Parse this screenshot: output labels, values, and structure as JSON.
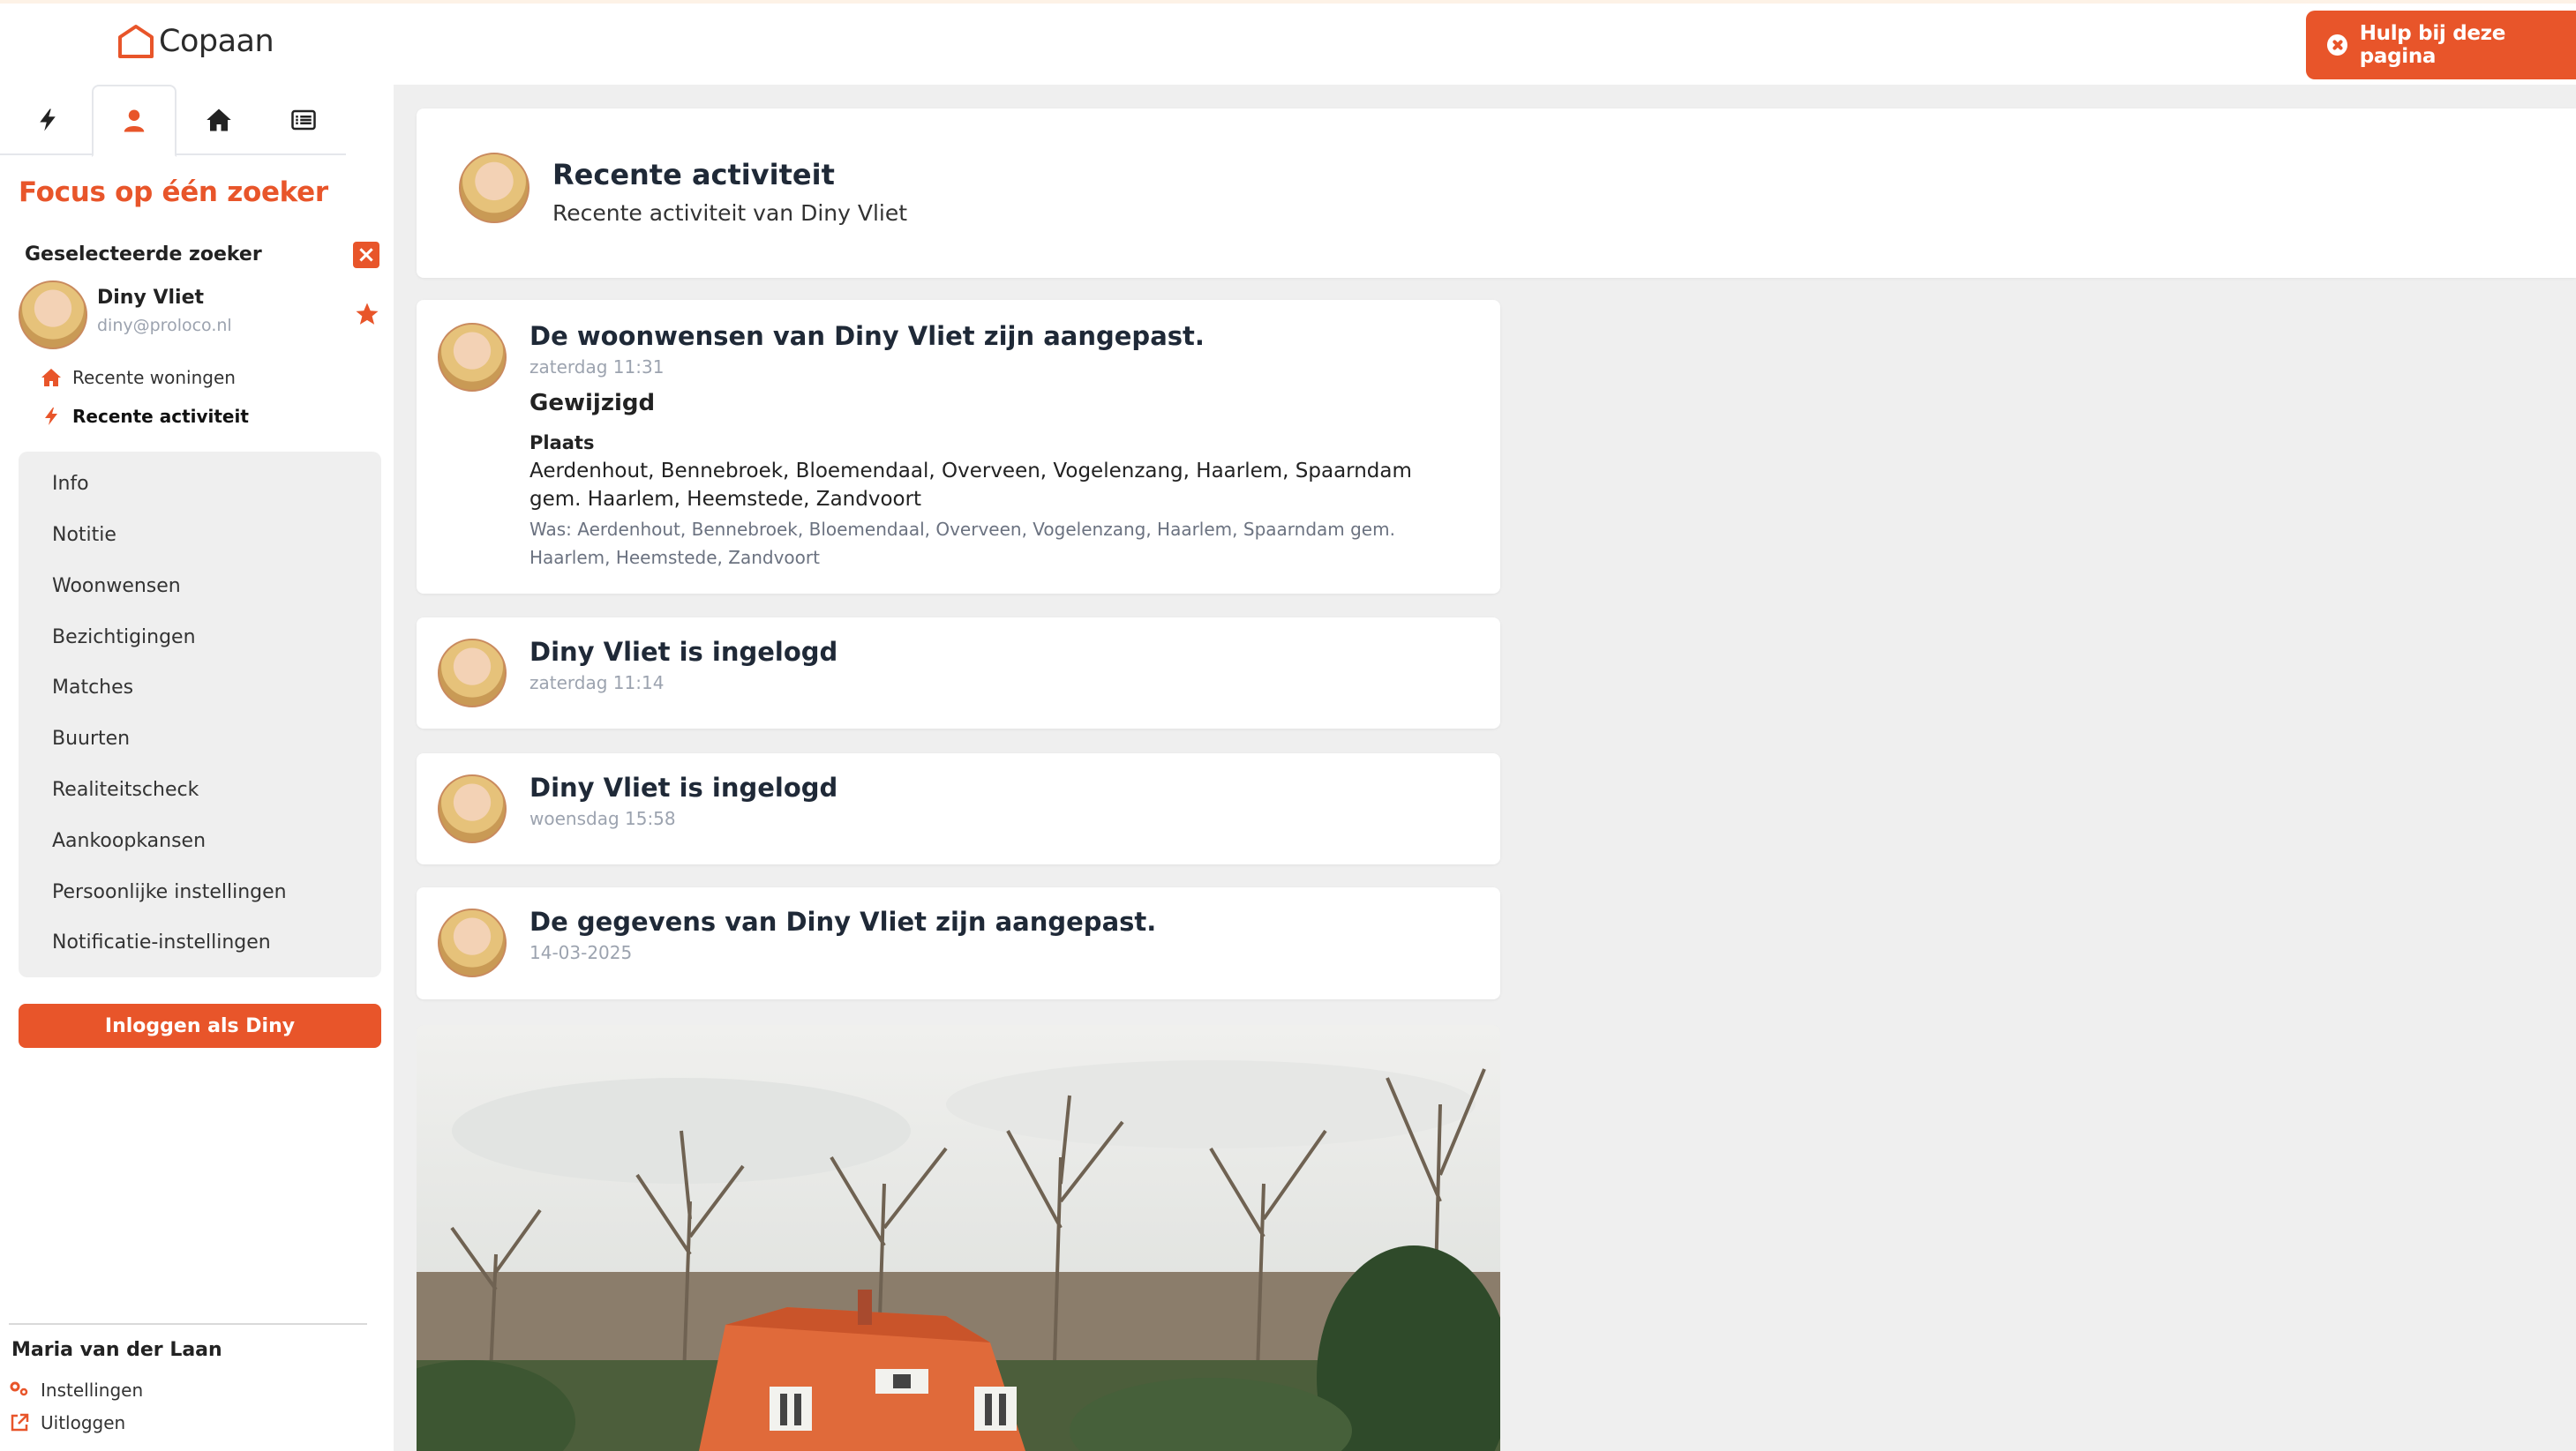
{
  "app": {
    "logo_text": "Copaan",
    "help_button": "Hulp bij deze pagina"
  },
  "sidebar": {
    "tabs": [
      {
        "icon": "bolt-icon",
        "active": false
      },
      {
        "icon": "user-icon",
        "active": true
      },
      {
        "icon": "home-icon",
        "active": false
      },
      {
        "icon": "list-icon",
        "active": false
      }
    ],
    "title": "Focus op één zoeker",
    "selected_label": "Geselecteerde zoeker",
    "selected": {
      "name": "Diny Vliet",
      "email": "diny@proloco.nl"
    },
    "quick_links": [
      "Recente woningen",
      "Recente activiteit"
    ],
    "menu": [
      "Info",
      "Notitie",
      "Woonwensen",
      "Bezichtigingen",
      "Matches",
      "Buurten",
      "Realiteitscheck",
      "Aankoopkansen",
      "Persoonlijke instellingen",
      "Notificatie-instellingen"
    ],
    "login_button": "Inloggen als Diny",
    "account": {
      "name": "Maria van der Laan",
      "settings": "Instellingen",
      "logout": "Uitloggen"
    }
  },
  "header": {
    "title": "Recente activiteit",
    "subtitle": "Recente activiteit van Diny Vliet"
  },
  "feed": [
    {
      "title": "De woonwensen van Diny Vliet zijn aangepast.",
      "time": "zaterdag 11:31",
      "change_heading": "Gewijzigd",
      "field": "Plaats",
      "new_value": "Aerdenhout, Bennebroek, Bloemendaal, Overveen, Vogelenzang, Haarlem, Spaarndam gem. Haarlem, Heemstede, Zandvoort",
      "old_value": "Was: Aerdenhout, Bennebroek, Bloemendaal, Overveen, Vogelenzang, Haarlem, Spaarndam gem. Haarlem, Heemstede, Zandvoort"
    },
    {
      "title": "Diny Vliet is ingelogd",
      "time": "zaterdag 11:14"
    },
    {
      "title": "Diny Vliet is ingelogd",
      "time": "woensdag 15:58"
    },
    {
      "title": "De gegevens van Diny Vliet zijn aangepast.",
      "time": "14-03-2025"
    }
  ],
  "colors": {
    "accent": "#e8552a",
    "background": "#efefef",
    "card": "#ffffff",
    "muted": "#9ca3af"
  }
}
